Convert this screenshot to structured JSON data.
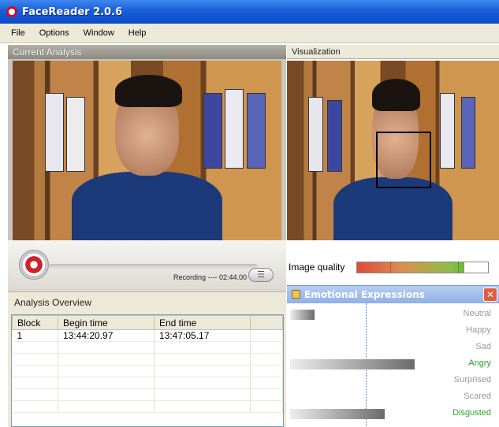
{
  "window": {
    "title": "FaceReader 2.0.6"
  },
  "menu": [
    "File",
    "Options",
    "Window",
    "Help"
  ],
  "current_analysis": {
    "header": "Current Analysis",
    "recording_status": "Recording ---- 02:44.00"
  },
  "analysis_overview": {
    "header": "Analysis Overview",
    "columns": [
      "Block",
      "Begin time",
      "End time"
    ],
    "rows": [
      [
        "1",
        "13:44:20.97",
        "13:47:05.17"
      ]
    ]
  },
  "visualization": {
    "header": "Visualization",
    "image_quality_label": "Image quality",
    "image_quality_level": 0.82
  },
  "emotional_expressions": {
    "title": "Emotional Expressions",
    "close_glyph": "✕",
    "items": [
      {
        "label": "Neutral",
        "value": 0.12,
        "highlight": false
      },
      {
        "label": "Happy",
        "value": 0.0,
        "highlight": false
      },
      {
        "label": "Sad",
        "value": 0.0,
        "highlight": false
      },
      {
        "label": "Angry",
        "value": 0.62,
        "highlight": true
      },
      {
        "label": "Surprised",
        "value": 0.0,
        "highlight": false
      },
      {
        "label": "Scared",
        "value": 0.0,
        "highlight": false
      },
      {
        "label": "Disgusted",
        "value": 0.47,
        "highlight": true
      }
    ]
  },
  "colors": {
    "titlebar": "#1a5fd8",
    "highlight_text": "#2aa52a",
    "record": "#d0202a"
  },
  "icons": [
    "app-icon",
    "record-icon",
    "list-icon",
    "panel-icon",
    "close-icon"
  ]
}
